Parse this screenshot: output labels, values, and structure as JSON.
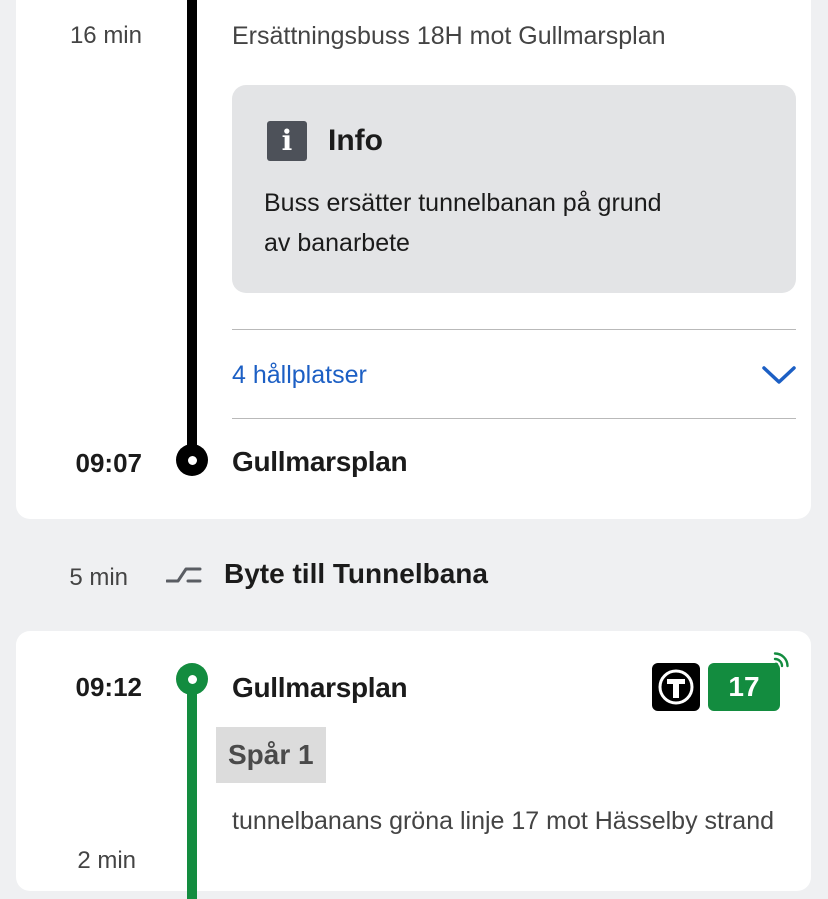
{
  "leg1": {
    "duration": "16 min",
    "description": "Ersättningsbuss 18H mot Gullmarsplan",
    "info": {
      "title": "Info",
      "body": "Buss ersätter tunnelbanan på grund av banarbete"
    },
    "stops_label": "4 hållplatser",
    "arrival_time": "09:07",
    "arrival_stop": "Gullmarsplan",
    "line_color": "#000000"
  },
  "transfer": {
    "duration": "5 min",
    "label": "Byte till Tunnelbana"
  },
  "leg2": {
    "departure_time": "09:12",
    "departure_stop": "Gullmarsplan",
    "mode_icon": "metro-t-icon",
    "line_number": "17",
    "line_color": "#138c3f",
    "track": "Spår 1",
    "description": "tunnelbanans gröna linje 17 mot Hässelby strand",
    "duration": "2 min"
  },
  "colors": {
    "link": "#1c5fc4",
    "green": "#138c3f",
    "background": "#eff0f2"
  }
}
